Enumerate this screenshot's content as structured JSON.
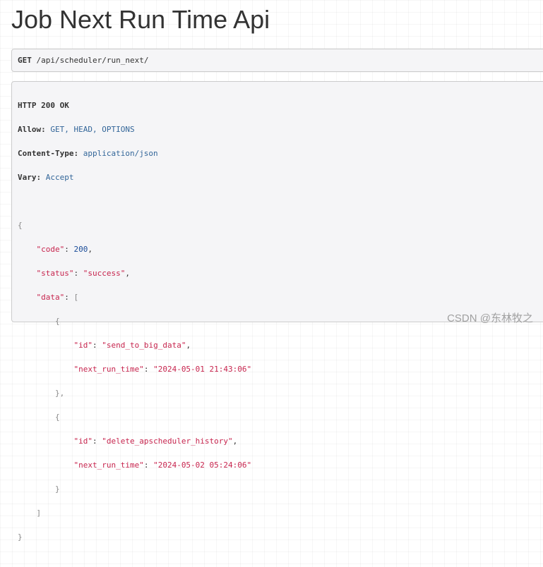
{
  "page": {
    "title": "Job Next Run Time Api"
  },
  "request": {
    "method": "GET",
    "path": "/api/scheduler/run_next/"
  },
  "response": {
    "status_line": "HTTP 200 OK",
    "headers": [
      {
        "name": "Allow:",
        "value": "GET, HEAD, OPTIONS"
      },
      {
        "name": "Content-Type:",
        "value": "application/json"
      },
      {
        "name": "Vary:",
        "value": "Accept"
      }
    ],
    "body": {
      "code_key": "\"code\"",
      "code_value": "200",
      "status_key": "\"status\"",
      "status_value": "\"success\"",
      "data_key": "\"data\"",
      "items": [
        {
          "id_key": "\"id\"",
          "id_value": "\"send_to_big_data\"",
          "next_run_time_key": "\"next_run_time\"",
          "next_run_time_value": "\"2024-05-01 21:43:06\""
        },
        {
          "id_key": "\"id\"",
          "id_value": "\"delete_apscheduler_history\"",
          "next_run_time_key": "\"next_run_time\"",
          "next_run_time_value": "\"2024-05-02 05:24:06\""
        }
      ]
    }
  },
  "watermark": "CSDN @东林牧之",
  "colors": {
    "json_key": "#c7254e",
    "json_string": "#c7254e",
    "json_number": "#1a4c99",
    "header_value": "#336699",
    "box_background": "#f5f5f7",
    "box_border": "#cccccc"
  }
}
